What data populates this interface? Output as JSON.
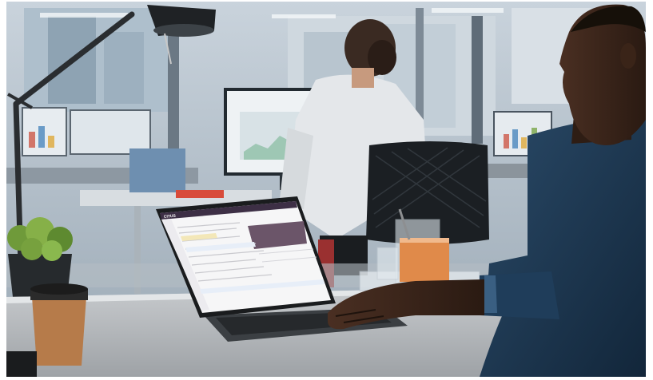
{
  "photo": {
    "description_free": true
  },
  "laptop_screen": {
    "brand": "CITUS"
  },
  "colors": {
    "app_header": "#3d2f45",
    "panel_accent": "#6b5569",
    "shirt": "#1d3a55"
  }
}
